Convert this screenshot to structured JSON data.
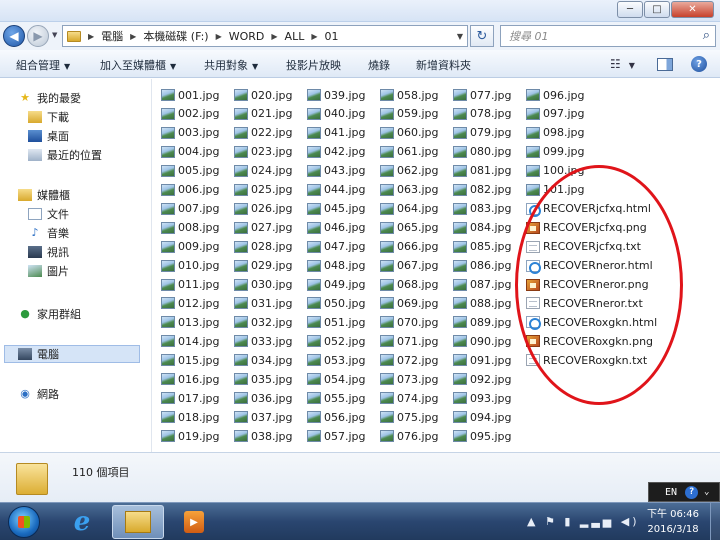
{
  "window": {
    "min_icon": "minimize-icon",
    "max_icon": "maximize-icon",
    "close_icon": "close-icon",
    "min_glyph": "─",
    "max_glyph": "□",
    "close_glyph": "✕"
  },
  "address": {
    "segments": [
      "電腦",
      "本機磁碟 (F:)",
      "WORD",
      "ALL",
      "01"
    ],
    "search_placeholder": "搜尋 01",
    "back_glyph": "◀",
    "forward_glyph": "▶",
    "refresh_glyph": "↻",
    "search_glyph": "⌕"
  },
  "toolbar": {
    "organize": "組合管理",
    "add_to_library": "加入至媒體櫃",
    "share": "共用對象",
    "slideshow": "投影片放映",
    "burn": "燒錄",
    "new_folder": "新增資料夾",
    "views_glyph": "☷",
    "help_glyph": "?",
    "dropdown_glyph": "▼"
  },
  "nav": {
    "favorites": "我的最愛",
    "downloads": "下載",
    "desktop": "桌面",
    "recent": "最近的位置",
    "libraries": "媒體櫃",
    "documents": "文件",
    "music": "音樂",
    "videos": "視訊",
    "pictures": "圖片",
    "homegroup": "家用群組",
    "computer": "電腦",
    "network": "網路"
  },
  "files": {
    "col1": [
      "001.jpg",
      "002.jpg",
      "003.jpg",
      "004.jpg",
      "005.jpg",
      "006.jpg",
      "007.jpg",
      "008.jpg",
      "009.jpg",
      "010.jpg",
      "011.jpg",
      "012.jpg",
      "013.jpg",
      "014.jpg",
      "015.jpg",
      "016.jpg",
      "017.jpg",
      "018.jpg",
      "019.jpg"
    ],
    "col2": [
      "020.jpg",
      "021.jpg",
      "022.jpg",
      "023.jpg",
      "024.jpg",
      "025.jpg",
      "026.jpg",
      "027.jpg",
      "028.jpg",
      "029.jpg",
      "030.jpg",
      "031.jpg",
      "032.jpg",
      "033.jpg",
      "034.jpg",
      "035.jpg",
      "036.jpg",
      "037.jpg",
      "038.jpg"
    ],
    "col3": [
      "039.jpg",
      "040.jpg",
      "041.jpg",
      "042.jpg",
      "043.jpg",
      "044.jpg",
      "045.jpg",
      "046.jpg",
      "047.jpg",
      "048.jpg",
      "049.jpg",
      "050.jpg",
      "051.jpg",
      "052.jpg",
      "053.jpg",
      "054.jpg",
      "055.jpg",
      "056.jpg",
      "057.jpg"
    ],
    "col4": [
      "058.jpg",
      "059.jpg",
      "060.jpg",
      "061.jpg",
      "062.jpg",
      "063.jpg",
      "064.jpg",
      "065.jpg",
      "066.jpg",
      "067.jpg",
      "068.jpg",
      "069.jpg",
      "070.jpg",
      "071.jpg",
      "072.jpg",
      "073.jpg",
      "074.jpg",
      "075.jpg",
      "076.jpg"
    ],
    "col5": [
      "077.jpg",
      "078.jpg",
      "079.jpg",
      "080.jpg",
      "081.jpg",
      "082.jpg",
      "083.jpg",
      "084.jpg",
      "085.jpg",
      "086.jpg",
      "087.jpg",
      "088.jpg",
      "089.jpg",
      "090.jpg",
      "091.jpg",
      "092.jpg",
      "093.jpg",
      "094.jpg",
      "095.jpg"
    ],
    "col6": [
      "096.jpg",
      "097.jpg",
      "098.jpg",
      "099.jpg",
      "100.jpg",
      "101.jpg",
      "RECOVERjcfxq.html",
      "RECOVERjcfxq.png",
      "RECOVERjcfxq.txt",
      "RECOVERneror.html",
      "RECOVERneror.png",
      "RECOVERneror.txt",
      "RECOVERoxgkn.html",
      "RECOVERoxgkn.png",
      "RECOVERoxgkn.txt"
    ]
  },
  "annotation": {
    "color": "#e0141a"
  },
  "status": {
    "count": "110 個項目"
  },
  "lang": {
    "code": "EN",
    "help_glyph": "?",
    "more_glyph": "⌄"
  },
  "taskbar": {
    "ie_glyph": "e",
    "media_glyph": "▶",
    "tray_glyphs": "▲ ⚑ ▮ ▂▃▅ ◀)",
    "time": "下午 06:46",
    "date": "2016/3/18"
  }
}
